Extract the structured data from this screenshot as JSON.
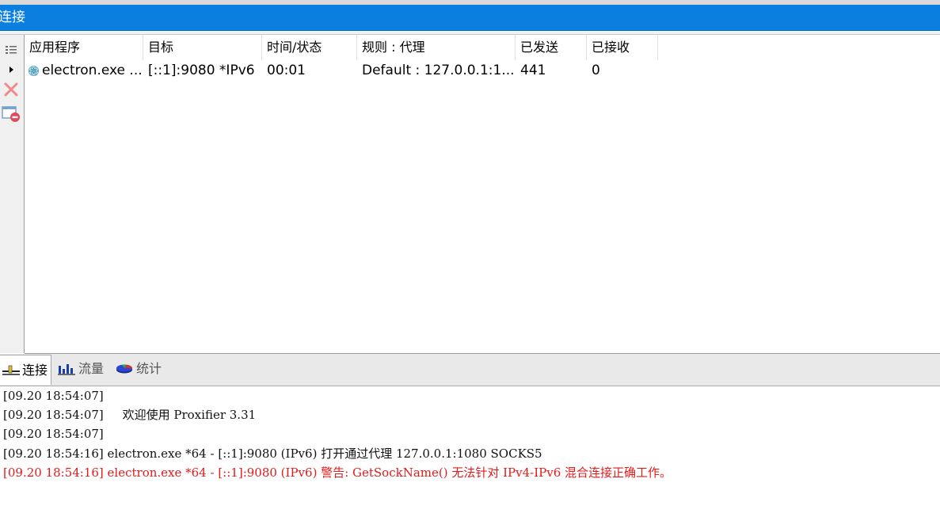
{
  "window": {
    "title": "连接"
  },
  "table": {
    "headers": [
      "应用程序",
      "目标",
      "时间/状态",
      "规则 : 代理",
      "已发送",
      "已接收"
    ],
    "rows": [
      [
        "electron.exe ...",
        "[::1]:9080 *IPv6",
        "00:01",
        "Default : 127.0.0.1:1...",
        "441",
        "0"
      ]
    ]
  },
  "tabs": [
    {
      "label": "连接",
      "icon": "connections-icon",
      "active": true
    },
    {
      "label": "流量",
      "icon": "traffic-chart-icon",
      "active": false
    },
    {
      "label": "统计",
      "icon": "statistics-pie-icon",
      "active": false
    }
  ],
  "log": [
    {
      "text": "[09.20 18:54:07]",
      "level": "info"
    },
    {
      "text": "[09.20 18:54:07]     欢迎使用 Proxifier 3.31",
      "level": "info"
    },
    {
      "text": "[09.20 18:54:07]",
      "level": "info"
    },
    {
      "text": "[09.20 18:54:16] electron.exe *64 - [::1]:9080 (IPv6) 打开通过代理 127.0.0.1:1080 SOCKS5",
      "level": "info"
    },
    {
      "text": "[09.20 18:54:16] electron.exe *64 - [::1]:9080 (IPv6) 警告: GetSockName() 无法针对 IPv4-IPv6 混合连接正确工作。",
      "level": "warning"
    }
  ],
  "colors": {
    "titlebar": "#0a7fe0",
    "warning": "#e21b1b"
  }
}
